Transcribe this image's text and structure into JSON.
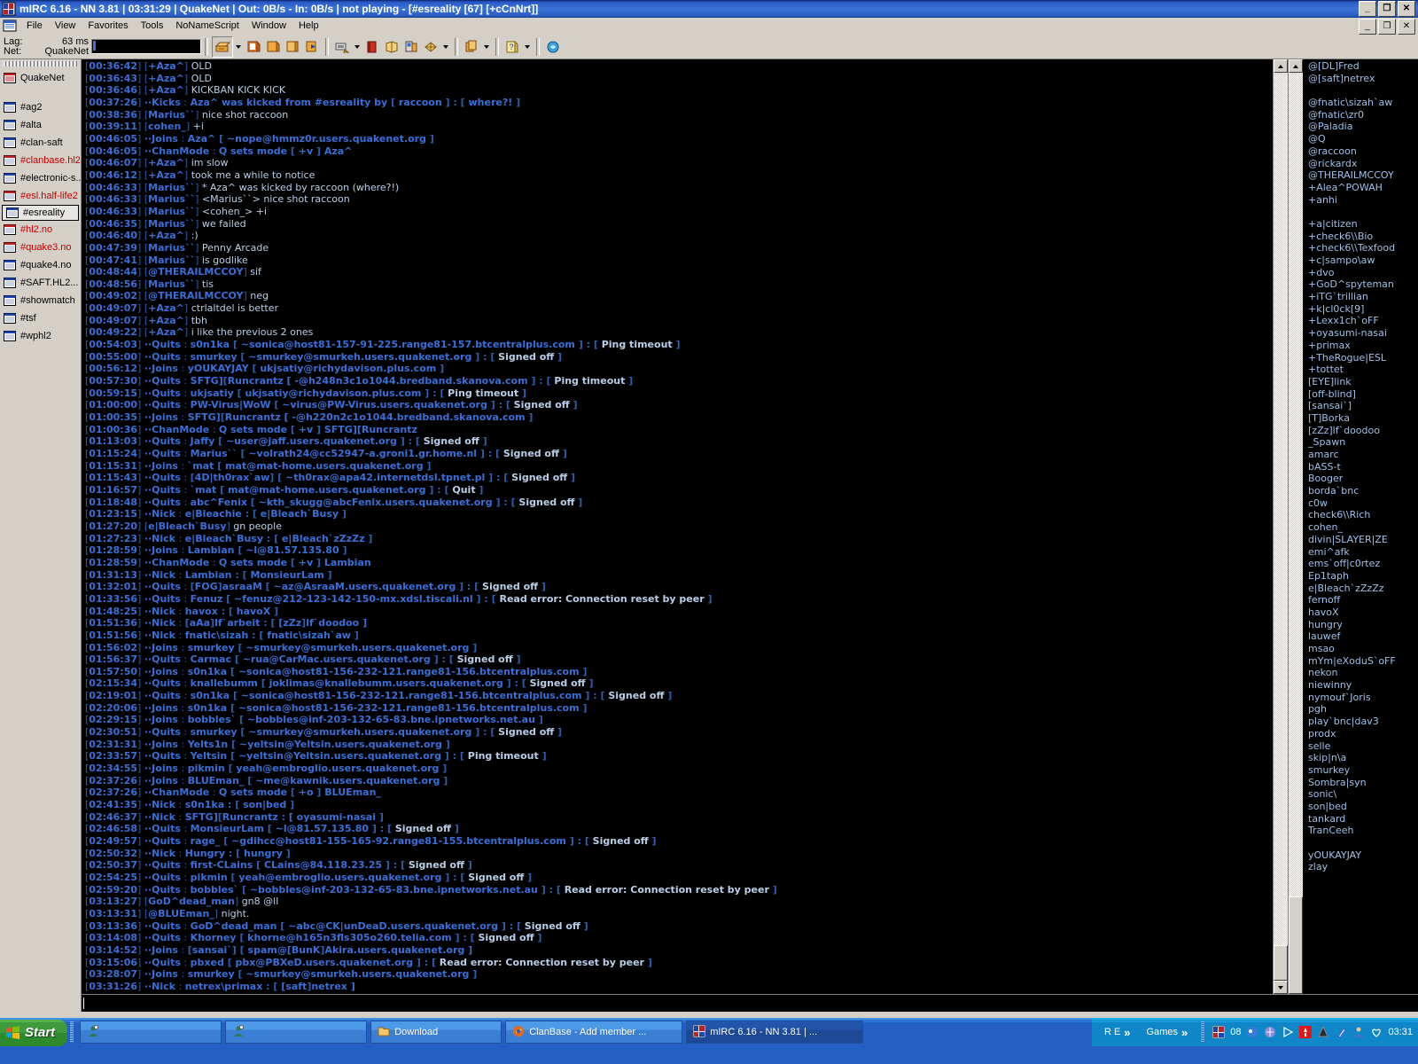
{
  "window": {
    "title": "mIRC 6.16 - NN 3.81  |  03:31:29  |  QuakeNet  |  Out: 0B/s - In: 0B/s  |  not playing - [#esreality [67] [+cCnNrt]]",
    "minimize": "_",
    "maximize": "❐",
    "close": "✕"
  },
  "menu": {
    "items": [
      "File",
      "View",
      "Favorites",
      "Tools",
      "NoNameScript",
      "Window",
      "Help"
    ],
    "mdi_minimize": "_",
    "mdi_restore": "❐",
    "mdi_close": "✕"
  },
  "toolbar": {
    "lag_label": "Lag:",
    "lag_value": "63 ms",
    "net_label": "Net:",
    "net_value": "QuakeNet"
  },
  "switchbar": {
    "status": {
      "label": "QuakeNet",
      "state": "normal"
    },
    "channels": [
      {
        "label": "#ag2",
        "state": "normal"
      },
      {
        "label": "#alta",
        "state": "normal"
      },
      {
        "label": "#clan-saft",
        "state": "normal"
      },
      {
        "label": "#clanbase.hl2",
        "state": "activity"
      },
      {
        "label": "#electronic-s...",
        "state": "normal"
      },
      {
        "label": "#esl.half-life2",
        "state": "activity"
      },
      {
        "label": "#esreality",
        "state": "active"
      },
      {
        "label": "#hl2.no",
        "state": "activity"
      },
      {
        "label": "#quake3.no",
        "state": "activity"
      },
      {
        "label": "#quake4.no",
        "state": "normal"
      },
      {
        "label": "#SAFT.HL2...",
        "state": "normal"
      },
      {
        "label": "#showmatch",
        "state": "normal"
      },
      {
        "label": "#tsf",
        "state": "normal"
      },
      {
        "label": "#wphl2",
        "state": "normal"
      }
    ]
  },
  "chat": {
    "lines": [
      {
        "ts": "00:36:42",
        "kind": "msg",
        "nick": "+Aza^",
        "text": "OLD"
      },
      {
        "ts": "00:36:43",
        "kind": "msg",
        "nick": "+Aza^",
        "text": "OLD"
      },
      {
        "ts": "00:36:46",
        "kind": "msg",
        "nick": "+Aza^",
        "text": "KICKBAN KICK KICK"
      },
      {
        "ts": "00:37:26",
        "kind": "event",
        "event": "Kicks",
        "text": "Aza^ was kicked from #esreality by [ raccoon ] : [ where?! ]"
      },
      {
        "ts": "00:38:36",
        "kind": "msg",
        "nick": "Marius``",
        "text": "nice shot raccoon"
      },
      {
        "ts": "00:39:11",
        "kind": "msg",
        "nick": "cohen_",
        "text": "+i"
      },
      {
        "ts": "00:46:05",
        "kind": "event",
        "event": "Joins",
        "text": "Aza^ [ ~nope@hmmz0r.users.quakenet.org ]"
      },
      {
        "ts": "00:46:05",
        "kind": "event",
        "event": "ChanMode",
        "text": "Q sets mode [ +v ] Aza^"
      },
      {
        "ts": "00:46:07",
        "kind": "msg",
        "nick": "+Aza^",
        "text": "im slow"
      },
      {
        "ts": "00:46:12",
        "kind": "msg",
        "nick": "+Aza^",
        "text": "took me a while to notice"
      },
      {
        "ts": "00:46:33",
        "kind": "msg",
        "nick": "Marius``",
        "text": "* Aza^ was kicked by raccoon (where?!)"
      },
      {
        "ts": "00:46:33",
        "kind": "msg",
        "nick": "Marius``",
        "text": "<Marius``> nice shot raccoon"
      },
      {
        "ts": "00:46:33",
        "kind": "msg",
        "nick": "Marius``",
        "text": "<cohen_> +i"
      },
      {
        "ts": "00:46:35",
        "kind": "msg",
        "nick": "Marius``",
        "text": "we failed"
      },
      {
        "ts": "00:46:40",
        "kind": "msg",
        "nick": "+Aza^",
        "text": ":)"
      },
      {
        "ts": "00:47:39",
        "kind": "msg",
        "nick": "Marius``",
        "text": "Penny Arcade"
      },
      {
        "ts": "00:47:41",
        "kind": "msg",
        "nick": "Marius``",
        "text": "is godlike"
      },
      {
        "ts": "00:48:44",
        "kind": "msg",
        "nick": "@THERAILMCCOY",
        "text": "sif"
      },
      {
        "ts": "00:48:56",
        "kind": "msg",
        "nick": "Marius``",
        "text": "tis"
      },
      {
        "ts": "00:49:02",
        "kind": "msg",
        "nick": "@THERAILMCCOY",
        "text": "neg"
      },
      {
        "ts": "00:49:07",
        "kind": "msg",
        "nick": "+Aza^",
        "text": "ctrlaltdel is better"
      },
      {
        "ts": "00:49:07",
        "kind": "msg",
        "nick": "+Aza^",
        "text": "tbh"
      },
      {
        "ts": "00:49:22",
        "kind": "msg",
        "nick": "+Aza^",
        "text": "i like the previous 2 ones"
      },
      {
        "ts": "00:54:03",
        "kind": "event",
        "event": "Quits",
        "text": "s0n1ka [ ~sonica@host81-157-91-225.range81-157.btcentralplus.com ] : [ Ping timeout ]"
      },
      {
        "ts": "00:55:00",
        "kind": "event",
        "event": "Quits",
        "text": "smurkey [ ~smurkey@smurkeh.users.quakenet.org ] : [ Signed off ]"
      },
      {
        "ts": "00:56:12",
        "kind": "event",
        "event": "Joins",
        "text": "yOUKAYJAY [ ukjsatiy@richydavison.plus.com ]"
      },
      {
        "ts": "00:57:30",
        "kind": "event",
        "event": "Quits",
        "text": "SFTG][Runcrantz [ -@h248n3c1o1044.bredband.skanova.com ] : [ Ping timeout ]"
      },
      {
        "ts": "00:59:15",
        "kind": "event",
        "event": "Quits",
        "text": "ukjsatiy [ ukjsatiy@richydavison.plus.com ] : [ Ping timeout ]"
      },
      {
        "ts": "01:00:00",
        "kind": "event",
        "event": "Quits",
        "text": "PW-Virus|WoW [ ~virus@PW-Virus.users.quakenet.org ] : [ Signed off ]"
      },
      {
        "ts": "01:00:35",
        "kind": "event",
        "event": "Joins",
        "text": "SFTG][Runcrantz [ -@h220n2c1o1044.bredband.skanova.com ]"
      },
      {
        "ts": "01:00:36",
        "kind": "event",
        "event": "ChanMode",
        "text": "Q sets mode [ +v ] SFTG][Runcrantz"
      },
      {
        "ts": "01:13:03",
        "kind": "event",
        "event": "Quits",
        "text": "Jaffy [ ~user@jaff.users.quakenet.org ] : [ Signed off ]"
      },
      {
        "ts": "01:15:24",
        "kind": "event",
        "event": "Quits",
        "text": "Marius`` [ ~volrath24@cc52947-a.groni1.gr.home.nl ] : [ Signed off ]"
      },
      {
        "ts": "01:15:31",
        "kind": "event",
        "event": "Joins",
        "text": "`mat [ mat@mat-home.users.quakenet.org ]"
      },
      {
        "ts": "01:15:43",
        "kind": "event",
        "event": "Quits",
        "text": "[4D|th0rax`aw] [ ~th0rax@apa42.internetdsl.tpnet.pl ] : [ Signed off ]"
      },
      {
        "ts": "01:16:57",
        "kind": "event",
        "event": "Quits",
        "text": "`mat [ mat@mat-home.users.quakenet.org ] : [ Quit ]"
      },
      {
        "ts": "01:18:48",
        "kind": "event",
        "event": "Quits",
        "text": "abc^Fenix [ ~kth_skugg@abcFenix.users.quakenet.org ] : [ Signed off ]"
      },
      {
        "ts": "01:23:15",
        "kind": "event",
        "event": "Nick",
        "text": "e|Bleachie : [ e|Bleach`Busy ]"
      },
      {
        "ts": "01:27:20",
        "kind": "msg",
        "nick": "e|Bleach`Busy",
        "text": "gn people"
      },
      {
        "ts": "01:27:23",
        "kind": "event",
        "event": "Nick",
        "text": "e|Bleach`Busy : [ e|Bleach`zZzZz ]"
      },
      {
        "ts": "01:28:59",
        "kind": "event",
        "event": "Joins",
        "text": "Lambian [ ~l@81.57.135.80 ]"
      },
      {
        "ts": "01:28:59",
        "kind": "event",
        "event": "ChanMode",
        "text": "Q sets mode [ +v ] Lambian"
      },
      {
        "ts": "01:31:13",
        "kind": "event",
        "event": "Nick",
        "text": "Lambian : [ MonsieurLam ]"
      },
      {
        "ts": "01:32:01",
        "kind": "event",
        "event": "Quits",
        "text": "[FOG]asraaM [ ~az@AsraaM.users.quakenet.org ] : [ Signed off ]"
      },
      {
        "ts": "01:33:56",
        "kind": "event",
        "event": "Quits",
        "text": "Fenuz [ ~fenuz@212-123-142-150-mx.xdsl.tiscali.nl ] : [ Read error: Connection reset by peer ]"
      },
      {
        "ts": "01:48:25",
        "kind": "event",
        "event": "Nick",
        "text": "havox : [ havoX ]"
      },
      {
        "ts": "01:51:36",
        "kind": "event",
        "event": "Nick",
        "text": "[aAa]lf`arbeit : [ [zZz]lf`doodoo ]"
      },
      {
        "ts": "01:51:56",
        "kind": "event",
        "event": "Nick",
        "text": "fnatic\\sizah : [ fnatic\\sizah`aw ]"
      },
      {
        "ts": "01:56:02",
        "kind": "event",
        "event": "Joins",
        "text": "smurkey [ ~smurkey@smurkeh.users.quakenet.org ]"
      },
      {
        "ts": "01:56:37",
        "kind": "event",
        "event": "Quits",
        "text": "Carmac [ ~rua@CarMac.users.quakenet.org ] : [ Signed off ]"
      },
      {
        "ts": "01:57:50",
        "kind": "event",
        "event": "Joins",
        "text": "s0n1ka [ ~sonica@host81-156-232-121.range81-156.btcentralplus.com ]"
      },
      {
        "ts": "02:15:34",
        "kind": "event",
        "event": "Quits",
        "text": "knallebumm [ joklimas@knallebumm.users.quakenet.org ] : [ Signed off ]"
      },
      {
        "ts": "02:19:01",
        "kind": "event",
        "event": "Quits",
        "text": "s0n1ka [ ~sonica@host81-156-232-121.range81-156.btcentralplus.com ] : [ Signed off ]"
      },
      {
        "ts": "02:20:06",
        "kind": "event",
        "event": "Joins",
        "text": "s0n1ka [ ~sonica@host81-156-232-121.range81-156.btcentralplus.com ]"
      },
      {
        "ts": "02:29:15",
        "kind": "event",
        "event": "Joins",
        "text": "bobbles` [ ~bobbles@inf-203-132-65-83.bne.ipnetworks.net.au ]"
      },
      {
        "ts": "02:30:51",
        "kind": "event",
        "event": "Quits",
        "text": "smurkey [ ~smurkey@smurkeh.users.quakenet.org ] : [ Signed off ]"
      },
      {
        "ts": "02:31:31",
        "kind": "event",
        "event": "Joins",
        "text": "Yelts1n [ ~yeltsin@Yeltsin.users.quakenet.org ]"
      },
      {
        "ts": "02:33:57",
        "kind": "event",
        "event": "Quits",
        "text": "Yeltsin [ ~yeltsin@Yeltsin.users.quakenet.org ] : [ Ping timeout ]"
      },
      {
        "ts": "02:34:55",
        "kind": "event",
        "event": "Joins",
        "text": "pikmin [ yeah@embroglio.users.quakenet.org ]"
      },
      {
        "ts": "02:37:26",
        "kind": "event",
        "event": "Joins",
        "text": "BLUEman_ [ ~me@kawnik.users.quakenet.org ]"
      },
      {
        "ts": "02:37:26",
        "kind": "event",
        "event": "ChanMode",
        "text": "Q sets mode [ +o ] BLUEman_"
      },
      {
        "ts": "02:41:35",
        "kind": "event",
        "event": "Nick",
        "text": "s0n1ka : [ son|bed ]"
      },
      {
        "ts": "02:46:37",
        "kind": "event",
        "event": "Nick",
        "text": "SFTG][Runcrantz : [ oyasumi-nasai ]"
      },
      {
        "ts": "02:46:58",
        "kind": "event",
        "event": "Quits",
        "text": "MonsieurLam [ ~l@81.57.135.80 ] : [ Signed off ]"
      },
      {
        "ts": "02:49:57",
        "kind": "event",
        "event": "Quits",
        "text": "rage_ [ ~gdihcc@host81-155-165-92.range81-155.btcentralplus.com ] : [ Signed off ]"
      },
      {
        "ts": "02:50:32",
        "kind": "event",
        "event": "Nick",
        "text": "Hungry : [ hungry ]"
      },
      {
        "ts": "02:50:37",
        "kind": "event",
        "event": "Quits",
        "text": "first-CLains [ CLains@84.118.23.25 ] : [ Signed off ]"
      },
      {
        "ts": "02:54:25",
        "kind": "event",
        "event": "Quits",
        "text": "pikmin [ yeah@embroglio.users.quakenet.org ] : [ Signed off ]"
      },
      {
        "ts": "02:59:20",
        "kind": "event",
        "event": "Quits",
        "text": "bobbles` [ ~bobbles@inf-203-132-65-83.bne.ipnetworks.net.au ] : [ Read error: Connection reset by peer ]"
      },
      {
        "ts": "03:13:27",
        "kind": "msg",
        "nick": "GoD^dead_man",
        "text": "gn8 @ll"
      },
      {
        "ts": "03:13:31",
        "kind": "msg",
        "nick": "@BLUEman_",
        "text": "night."
      },
      {
        "ts": "03:13:36",
        "kind": "event",
        "event": "Quits",
        "text": "GoD^dead_man [ ~abc@CK|unDeaD.users.quakenet.org ] : [ Signed off ]"
      },
      {
        "ts": "03:14:08",
        "kind": "event",
        "event": "Quits",
        "text": "Khorney [ khorne@h165n3fls305o260.telia.com ] : [ Signed off ]"
      },
      {
        "ts": "03:14:52",
        "kind": "event",
        "event": "Joins",
        "text": "[sansai`] [ spam@[BunK]Akira.users.quakenet.org ]"
      },
      {
        "ts": "03:15:06",
        "kind": "event",
        "event": "Quits",
        "text": "pbxed [ pbx@PBXeD.users.quakenet.org ] : [ Read error: Connection reset by peer ]"
      },
      {
        "ts": "03:28:07",
        "kind": "event",
        "event": "Joins",
        "text": "smurkey [ ~smurkey@smurkeh.users.quakenet.org ]"
      },
      {
        "ts": "03:31:26",
        "kind": "event",
        "event": "Nick",
        "text": "netrex\\primax : [ [saft]netrex ]"
      }
    ]
  },
  "nicklist": {
    "nicks": [
      "@[DL]Fred",
      "@[saft]netrex",
      "",
      "@fnatic\\sizah`aw",
      "@fnatic\\zr0",
      "@Paladia",
      "@Q",
      "@raccoon",
      "@rickardx",
      "@THERAILMCCOY",
      "+Alea^POWAH",
      "+anhi",
      "",
      "+a|citizen",
      "+check6\\\\Bio",
      "+check6\\\\Texfood",
      "+c|sampo\\aw",
      "+dvo",
      "+GoD^spyteman",
      "+iTG`trillian",
      "+k|cl0ck[9]",
      "+Lexx1ch`oFF",
      "+oyasumi-nasai",
      "+primax",
      "+TheRogue|ESL",
      "+tottet",
      "[EYE]link",
      "[off-blind]",
      "[sansai`]",
      "[T]Borka",
      "[zZz]lf`doodoo",
      "_Spawn",
      "amarc",
      "bASS-t",
      "Booger",
      "borda`bnc",
      "c0w",
      "check6\\\\Rich",
      "cohen_",
      "divin|SLAYER|ZE",
      "emi^afk",
      "ems`off|c0rtez",
      "Ep1taph",
      "e|Bleach`zZzZz",
      "fernoff",
      "havoX",
      "hungry",
      "lauwef",
      "msao",
      "mYm|eXoduS`oFF",
      "nekon",
      "niewinny",
      "nymouf`Joris",
      "pgh",
      "play`bnc|dav3",
      "prodx",
      "selle",
      "skip|n\\a",
      "smurkey",
      "Sombra|syn",
      "sonic\\",
      "son|bed",
      "tankard",
      "TranCeeh",
      "",
      "yOUKAYJAY",
      "zlay"
    ]
  },
  "input": {
    "value": "",
    "placeholder": ""
  },
  "taskbar": {
    "start_label": "Start",
    "quicklaunch": [
      "quicklaunch-icon-1",
      "quicklaunch-icon-2"
    ],
    "tasks": [
      {
        "label": "",
        "icon": "person-icon",
        "active": false
      },
      {
        "label": "",
        "icon": "person-icon",
        "active": false
      },
      {
        "label": "Download",
        "icon": "folder-icon",
        "active": false
      },
      {
        "label": "ClanBase - Add member ...",
        "icon": "firefox-icon",
        "active": false
      },
      {
        "label": "mIRC 6.16 - NN 3.81 | ...",
        "icon": "mirc-icon",
        "active": true
      }
    ],
    "toolbars": [
      {
        "label": "R E",
        "chevron": "»"
      },
      {
        "label": "Games",
        "chevron": "»"
      }
    ],
    "tray_count": "08",
    "clock": "03:31"
  },
  "colors": {
    "title_blue": "#2b5dc4",
    "chat_bg": "#000000",
    "chat_nick": "#3a6fd8",
    "chat_text": "#b9cfe8",
    "face": "#d4d0c8",
    "activity_red": "#c00000"
  }
}
